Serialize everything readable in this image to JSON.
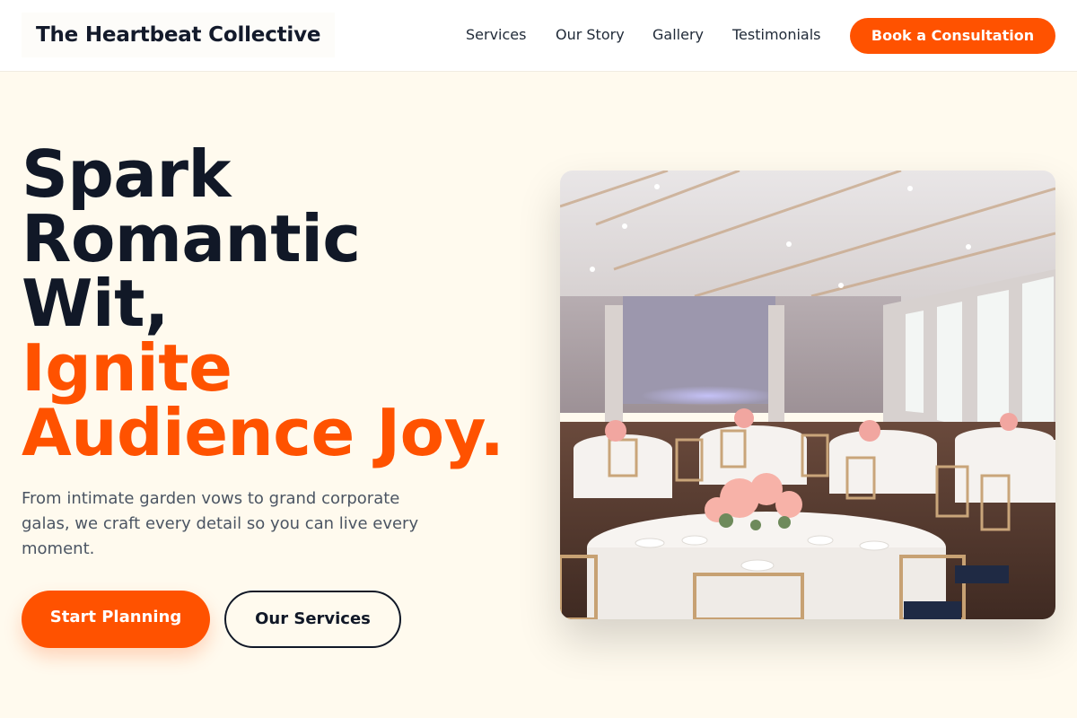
{
  "header": {
    "brand": "The Heartbeat Collective",
    "nav": [
      "Services",
      "Our Story",
      "Gallery",
      "Testimonials"
    ],
    "cta": "Book a Consultation"
  },
  "hero": {
    "headline_dark": [
      "Spark",
      "Romantic",
      "Wit,"
    ],
    "headline_accent": [
      "Ignite",
      "Audience Joy."
    ],
    "description": "From intimate garden vows to grand corporate galas, we craft every detail so you can live every moment.",
    "primary_button": "Start Planning",
    "secondary_button": "Our Services"
  },
  "colors": {
    "accent": "#ff5200",
    "dark": "#111827",
    "background": "#fffaee"
  }
}
